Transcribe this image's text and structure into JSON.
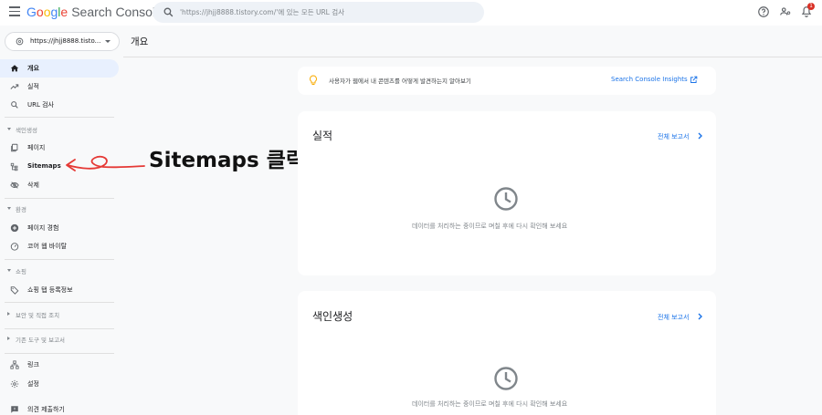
{
  "app": {
    "logo_google": [
      "G",
      "o",
      "o",
      "g",
      "l",
      "e"
    ],
    "product": "Search Console"
  },
  "search": {
    "placeholder": "'https://jhjj8888.tistory.com/'에 있는 모든 URL 검사"
  },
  "property": {
    "label": "https://jhjj8888.tisto..."
  },
  "sidebar": {
    "items": [
      {
        "label": "개요",
        "icon": "home-icon"
      },
      {
        "label": "실적",
        "icon": "trending-up-icon"
      },
      {
        "label": "URL 검사",
        "icon": "search-icon"
      }
    ],
    "sections": [
      {
        "title": "색인생성",
        "items": [
          {
            "label": "페이지",
            "icon": "pages-icon"
          },
          {
            "label": "Sitemaps",
            "icon": "sitemap-icon"
          },
          {
            "label": "삭제",
            "icon": "eye-off-icon"
          }
        ]
      },
      {
        "title": "환경",
        "items": [
          {
            "label": "페이지 경험",
            "icon": "plus-circle-icon"
          },
          {
            "label": "코어 웹 바이탈",
            "icon": "speed-gauge-icon"
          }
        ]
      },
      {
        "title": "쇼핑",
        "items": [
          {
            "label": "쇼핑 탭 등록정보",
            "icon": "tag-icon"
          }
        ]
      }
    ],
    "collapsed_sections": [
      "보안 및 직접 조치",
      "기존 도구 및 보고서"
    ],
    "bottom_items": [
      {
        "label": "링크",
        "icon": "links-icon"
      },
      {
        "label": "설정",
        "icon": "gear-icon"
      },
      {
        "label": "의견 제출하기",
        "icon": "feedback-icon"
      }
    ]
  },
  "annotation": {
    "text": "Sitemaps 클릭",
    "color": "#e53935"
  },
  "main": {
    "title": "개요",
    "insights": {
      "text": "사용자가 웹에서 내 콘텐츠를 어떻게 발견하는지 알아보기",
      "link": "Search Console Insights"
    },
    "cards": [
      {
        "title": "실적",
        "link": "전체 보고서",
        "message": "데이터를 처리하는 중이므로 며칠 후에 다시 확인해 보세요"
      },
      {
        "title": "색인생성",
        "link": "전체 보고서",
        "message": "데이터를 처리하는 중이므로 며칠 후에 다시 확인해 보세요"
      }
    ]
  },
  "notifications": {
    "count": "1"
  },
  "colors": {
    "accent": "#1a73e8",
    "active_bg": "#e8f0fe",
    "badge": "#d93025",
    "bulb": "#f9ab00"
  }
}
